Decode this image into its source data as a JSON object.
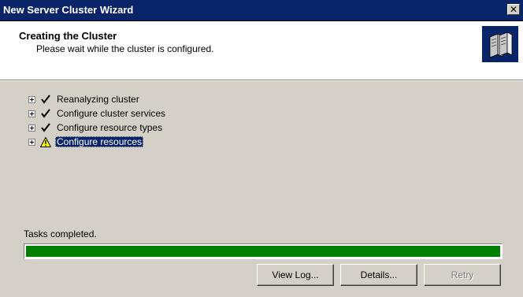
{
  "window": {
    "title": "New Server Cluster Wizard",
    "close_glyph": "✕"
  },
  "header": {
    "title": "Creating the Cluster",
    "subtitle": "Please wait while the cluster is configured.",
    "icon": "server-cluster-icon"
  },
  "tree": {
    "items": [
      {
        "label": "Reanalyzing cluster",
        "status": "checkmark-icon"
      },
      {
        "label": "Configure cluster services",
        "status": "checkmark-icon"
      },
      {
        "label": "Configure resource types",
        "status": "checkmark-icon"
      },
      {
        "label": "Configure resources",
        "status": "warning-icon",
        "selected": true
      }
    ]
  },
  "status": {
    "tasks_label": "Tasks completed.",
    "progress": 1.0,
    "progress_color": "#008000"
  },
  "buttons": {
    "view_log": "View Log...",
    "details": "Details...",
    "retry": "Retry"
  },
  "colors": {
    "titlebar": "#0a246a",
    "face": "#d4d0c8",
    "selection": "#0a246a"
  }
}
